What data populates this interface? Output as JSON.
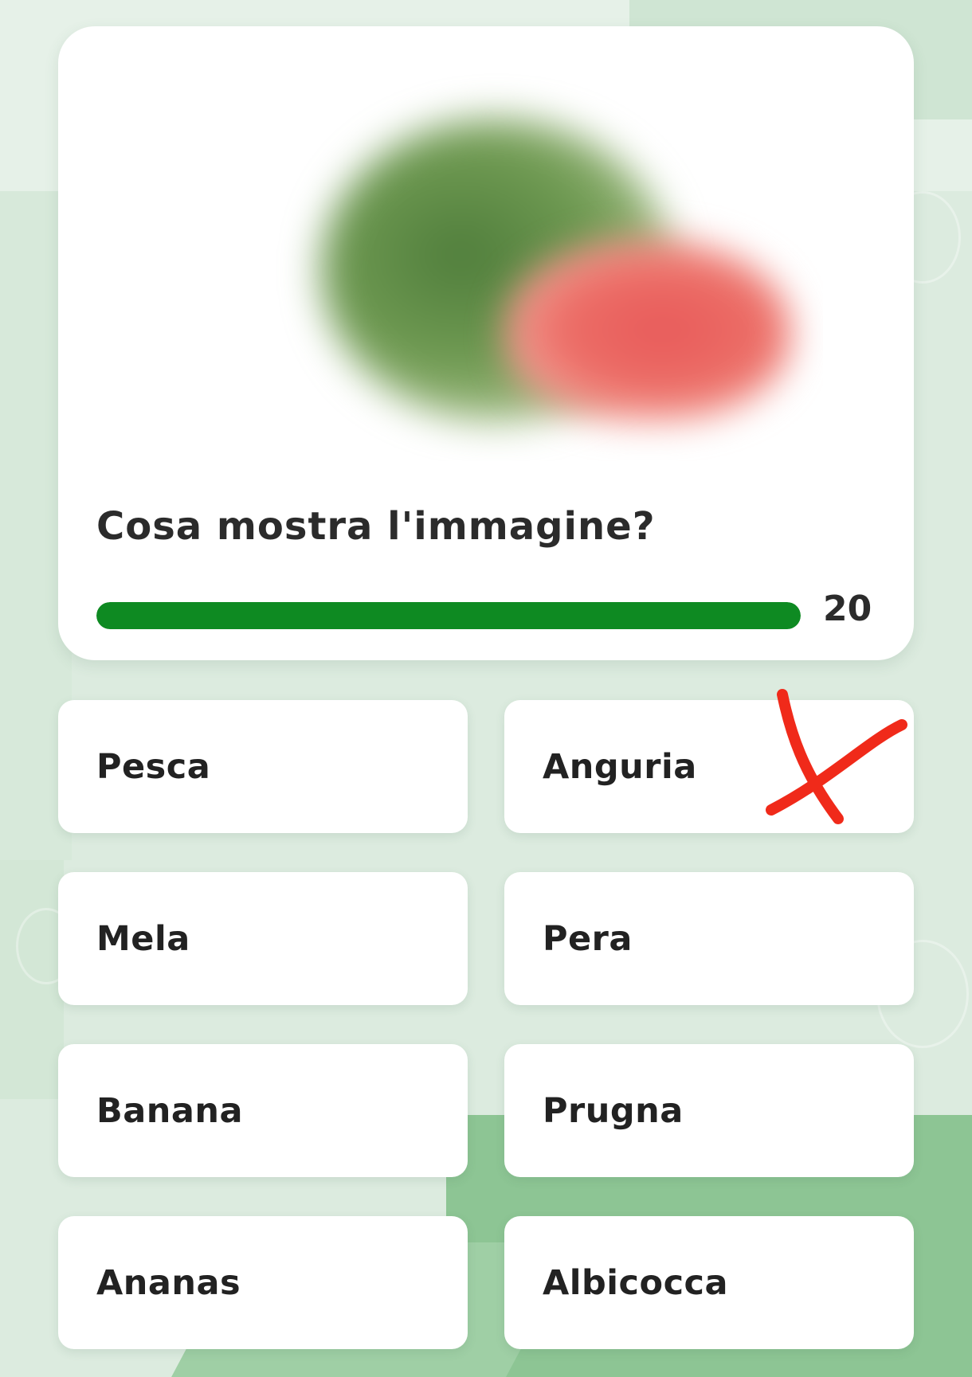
{
  "question": {
    "text": "Cosa mostra l'immagine?"
  },
  "timer": {
    "value": "20",
    "progress_fraction": 1.0,
    "fill_color": "#0e8a22"
  },
  "image": {
    "description_icon": "blurred-watermelon-image"
  },
  "answers": [
    {
      "label": "Pesca"
    },
    {
      "label": "Anguria"
    },
    {
      "label": "Mela"
    },
    {
      "label": "Pera"
    },
    {
      "label": "Banana"
    },
    {
      "label": "Prugna"
    },
    {
      "label": "Ananas"
    },
    {
      "label": "Albicocca"
    }
  ],
  "annotation": {
    "icon": "red-x-mark-icon",
    "color": "#f02a1a"
  }
}
